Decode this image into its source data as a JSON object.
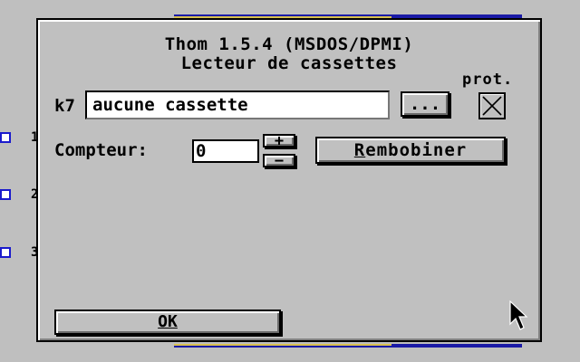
{
  "background": {
    "list_numbers": [
      "1",
      "2",
      "3"
    ]
  },
  "dialog": {
    "title_line1": "Thom 1.5.4 (MSDOS/DPMI)",
    "title_line2": "Lecteur de cassettes",
    "prot_label": "prot.",
    "protect_checked": true,
    "k7_label": "k7",
    "cassette_value": "aucune cassette",
    "browse_label": "...",
    "counter_label": "Compteur:",
    "counter_value": "0",
    "plus_label": "+",
    "minus_label": "−",
    "rewind_label": "Rembobiner",
    "ok_label": "OK"
  },
  "colors": {
    "dialog_bg": "#c0c0c0",
    "field_bg": "#ffffff",
    "accent_blue": "#1a1aa6",
    "accent_yellow": "#d8c050"
  },
  "icons": {
    "cursor": "mouse-pointer-icon",
    "protect": "checkbox-x-icon"
  }
}
